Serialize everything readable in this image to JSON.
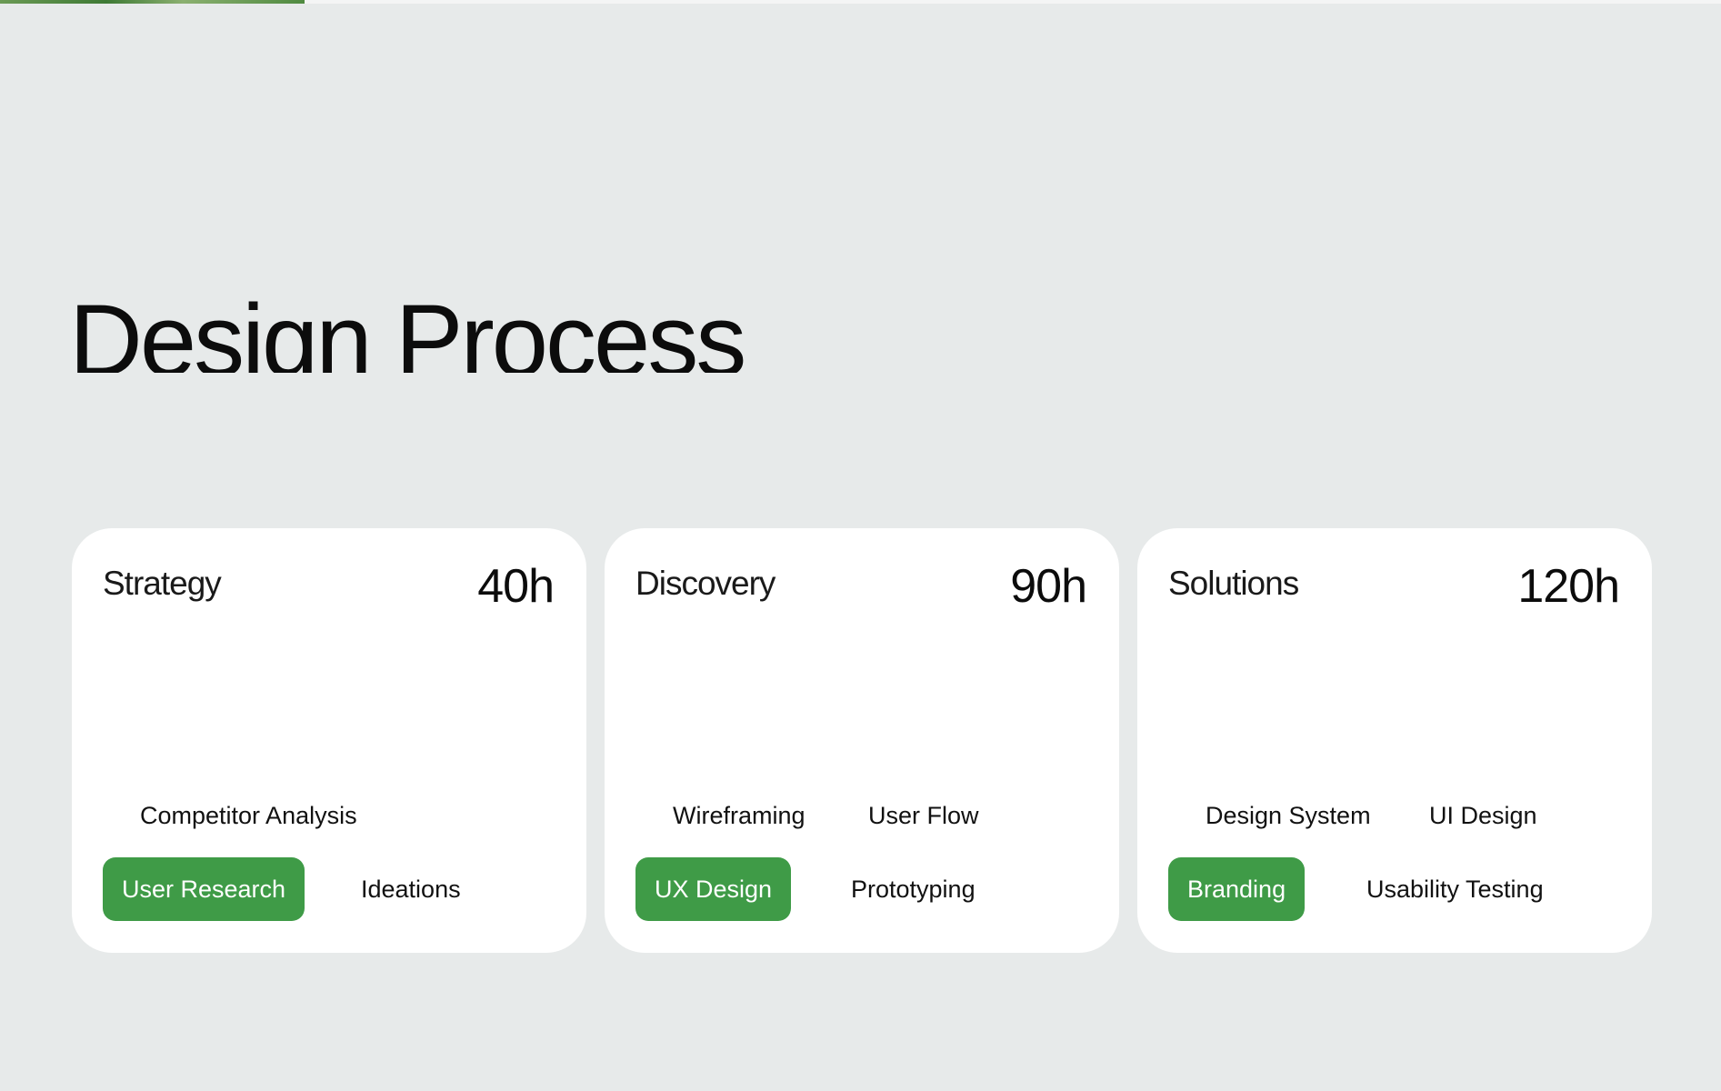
{
  "page_title": "Design Process",
  "accent_color": "#3f9b47",
  "cards": [
    {
      "title": "Strategy",
      "hours": "40h",
      "tags": {
        "row1a": "Competitor Analysis",
        "pill": "User Research",
        "row2b": "Ideations"
      }
    },
    {
      "title": "Discovery",
      "hours": "90h",
      "tags": {
        "row1a": "Wireframing",
        "row1b": "User Flow",
        "pill": "UX Design",
        "row2b": "Prototyping"
      }
    },
    {
      "title": "Solutions",
      "hours": "120h",
      "tags": {
        "row1a": "Design System",
        "row1b": "UI Design",
        "pill": "Branding",
        "row2b": "Usability Testing"
      }
    }
  ]
}
